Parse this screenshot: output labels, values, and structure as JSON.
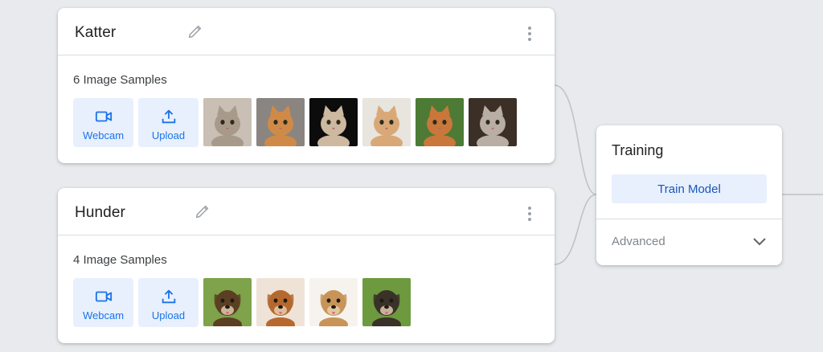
{
  "classes": [
    {
      "name": "Katter",
      "samples_label": "6 Image Samples",
      "webcam_label": "Webcam",
      "upload_label": "Upload",
      "thumbnails": [
        {
          "subject": "tabby cat, light grey",
          "bg": "#c9bfb4",
          "fur": "#a89a8a"
        },
        {
          "subject": "ginger cat lying",
          "bg": "#8a8580",
          "fur": "#d08a48"
        },
        {
          "subject": "cat on black background",
          "bg": "#0c0c0c",
          "fur": "#cdb8a0"
        },
        {
          "subject": "two fluffy cats",
          "bg": "#e8e4de",
          "fur": "#d9a877"
        },
        {
          "subject": "orange cat on green",
          "bg": "#4d7a35",
          "fur": "#c9773a"
        },
        {
          "subject": "scottish fold cat",
          "bg": "#3b2f26",
          "fur": "#b9aea3"
        }
      ]
    },
    {
      "name": "Hunder",
      "samples_label": "4 Image Samples",
      "webcam_label": "Webcam",
      "upload_label": "Upload",
      "thumbnails": [
        {
          "subject": "german shepherd on grass",
          "bg": "#7ea34a",
          "fur": "#5b3f22"
        },
        {
          "subject": "golden retriever",
          "bg": "#efe3d8",
          "fur": "#b6692e"
        },
        {
          "subject": "happy labrador",
          "bg": "#f6f3ef",
          "fur": "#c89457"
        },
        {
          "subject": "australian shepherd",
          "bg": "#6d9a3f",
          "fur": "#3a3128"
        }
      ]
    }
  ],
  "training": {
    "title": "Training",
    "train_button": "Train Model",
    "advanced_label": "Advanced"
  },
  "colors": {
    "accent": "#1a73e8",
    "button_bg": "#e8f0fe",
    "canvas_bg": "#e8eaed",
    "connector": "#bdc1c6"
  },
  "icons": [
    "pencil-icon",
    "more-vert-icon",
    "videocam-icon",
    "upload-icon",
    "chevron-down-icon"
  ]
}
